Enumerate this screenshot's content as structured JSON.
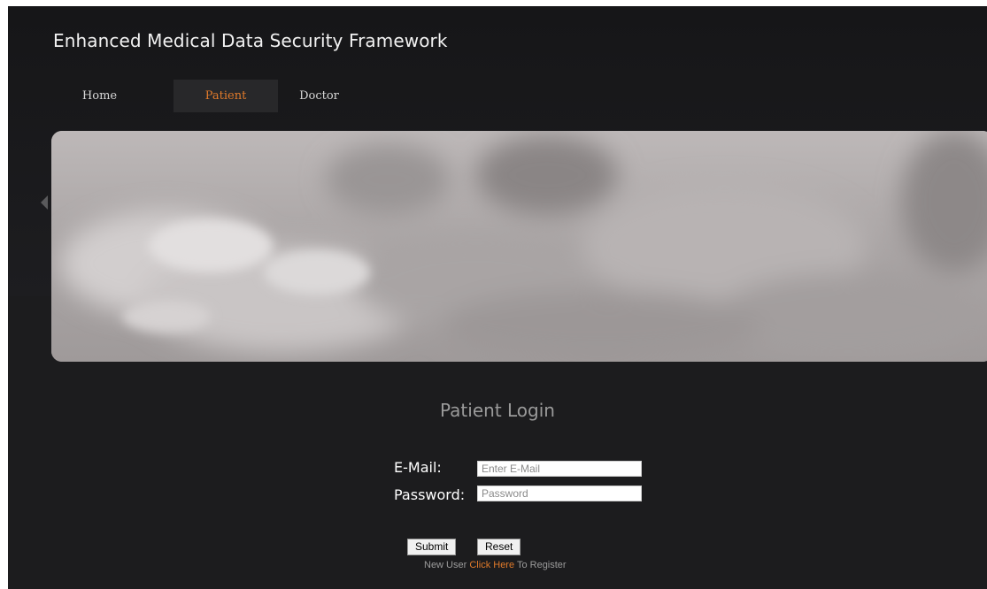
{
  "site": {
    "title": "Enhanced Medical Data Security Framework"
  },
  "nav": {
    "items": [
      {
        "label": "Home"
      },
      {
        "label": "Patient",
        "active": true
      },
      {
        "label": "Doctor"
      }
    ],
    "active_color": "#e07a2a"
  },
  "login": {
    "title": "Patient Login",
    "email_label": "E-Mail:",
    "email_placeholder": "Enter E-Mail",
    "email_value": "",
    "password_label": "Password:",
    "password_placeholder": "Password",
    "password_value": "",
    "submit_label": "Submit",
    "reset_label": "Reset"
  },
  "register": {
    "prefix": "New User",
    "link": "Click Here",
    "suffix": "To Register"
  },
  "colors": {
    "background": "#1c1c1e",
    "accent": "#e07a2a"
  }
}
